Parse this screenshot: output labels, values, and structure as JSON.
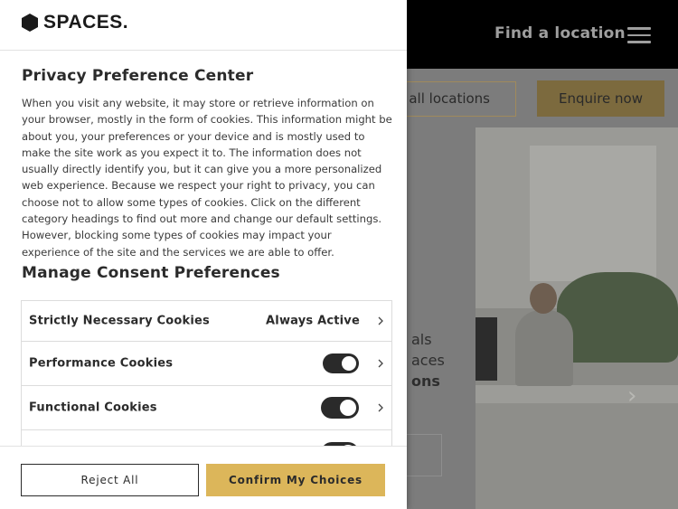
{
  "site": {
    "nav_find_location": "Find a location",
    "view_all_locations": "w all locations",
    "enquire_now": "Enquire now",
    "hero_lines": [
      "als",
      "aces",
      "ons"
    ]
  },
  "panel": {
    "logo_text": "SPACES.",
    "title": "Privacy Preference Center",
    "description": "When you visit any website, it may store or retrieve information on your browser, mostly in the form of cookies. This information might be about you, your preferences or your device and is mostly used to make the site work as you expect it to. The information does not usually directly identify you, but it can give you a more personalized web experience. Because we respect your right to privacy, you can choose not to allow some types of cookies. Click on the different category headings to find out more and change our default settings. However, blocking some types of cookies may impact your experience of the site and the services we are able to offer.",
    "manage_title": "Manage Consent Preferences",
    "categories": [
      {
        "label": "Strictly Necessary Cookies",
        "status": "Always Active"
      },
      {
        "label": "Performance Cookies",
        "enabled": true
      },
      {
        "label": "Functional Cookies",
        "enabled": true
      },
      {
        "label": "",
        "enabled": true
      }
    ],
    "reject_all": "Reject All",
    "confirm_choices": "Confirm My Choices"
  },
  "colors": {
    "accent": "#dcb65a",
    "toggle_on": "#2a2a2a",
    "header_bg": "#000000"
  }
}
